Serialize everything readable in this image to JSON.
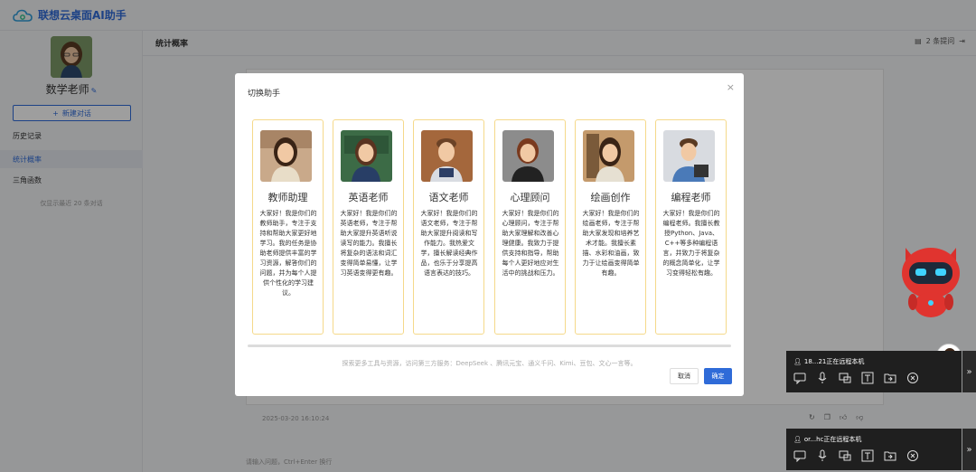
{
  "app": {
    "title": "联想云桌面AI助手"
  },
  "sidebar": {
    "teacher_name": "数学老师",
    "new_chat_label": "新建对话",
    "items": [
      {
        "label": "历史记录"
      },
      {
        "label": "统计概率"
      },
      {
        "label": "三角函数"
      }
    ],
    "note": "仅显示最近 20 条对话"
  },
  "main": {
    "header_title": "统计概率",
    "question_count": "2 条提问",
    "timestamp": "2025-03-20 16:10:24",
    "input_placeholder": "请输入问题，Ctrl+Enter 换行"
  },
  "modal": {
    "title": "切换助手",
    "close_icon": "close-icon",
    "cards": [
      {
        "name": "教师助理",
        "desc": "大家好！我是你们的教师助手，专注于支持和帮助大家更好地学习。我的任务是协助老师提供丰富的学习资源，解答你们的问题，并为每个人提供个性化的学习建议。"
      },
      {
        "name": "英语老师",
        "desc": "大家好！我是你们的英语老师，专注于帮助大家提升英语听说读写的能力。我擅长将复杂的语法和词汇变得简单易懂，让学习英语变得更有趣。"
      },
      {
        "name": "语文老师",
        "desc": "大家好！我是你们的语文老师，专注于帮助大家提升阅读和写作能力。我热爱文学，擅长解读经典作品，也乐于分享提高语言表达的技巧。"
      },
      {
        "name": "心理顾问",
        "desc": "大家好！我是你们的心理顾问，专注于帮助大家理解和改善心理健康。我致力于提供支持和指导，帮助每个人更好地应对生活中的挑战和压力。"
      },
      {
        "name": "绘画创作",
        "desc": "大家好！我是你们的绘画老师，专注于帮助大家发现和培养艺术才能。我擅长素描、水彩和油画，致力于让绘画变得简单有趣。"
      },
      {
        "name": "编程老师",
        "desc": "大家好！我是你们的编程老师。我擅长教授Python、Java、C++等多种编程语言，并致力于将复杂的概念简单化，让学习变得轻松有趣。"
      }
    ],
    "footer_note": "探索更多工具与资源，访问第三方服务：DeepSeek 、腾讯元宝、通义千问、Kimi、豆包、文心一言等。",
    "cancel_label": "取消",
    "ok_label": "确定"
  },
  "remote_panels": [
    {
      "title": "18...21正在远程本机"
    },
    {
      "title": "or...hc正在远程本机"
    }
  ],
  "colors": {
    "accent": "#2f6bd8",
    "card_border": "#f5d98a"
  }
}
